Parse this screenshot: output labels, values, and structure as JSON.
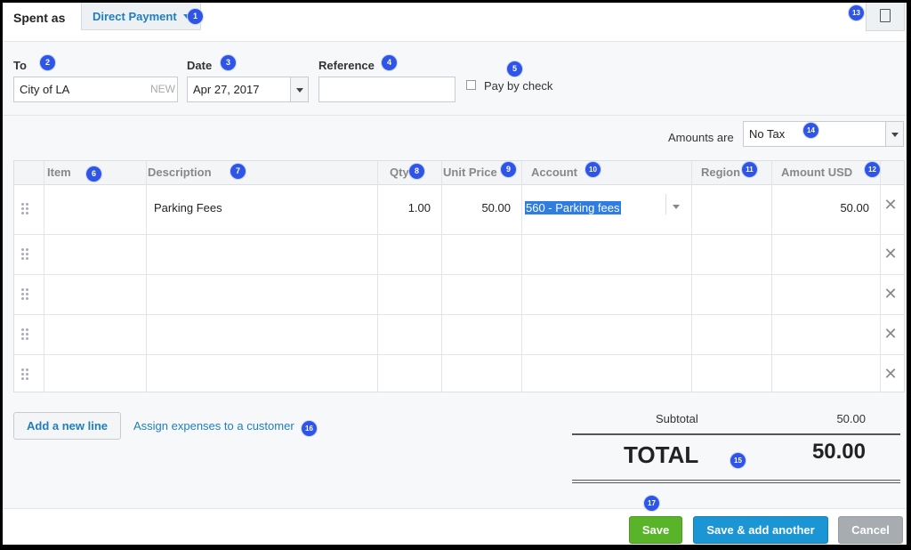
{
  "header": {
    "spent_as_label": "Spent as",
    "payment_type": "Direct Payment"
  },
  "fields": {
    "to_label": "To",
    "to_value": "City of LA",
    "to_new_tag": "NEW",
    "date_label": "Date",
    "date_value": "Apr 27, 2017",
    "reference_label": "Reference",
    "reference_value": "",
    "pay_by_check_label": "Pay by check",
    "pay_by_check_checked": false
  },
  "amounts": {
    "label": "Amounts are",
    "value": "No Tax"
  },
  "table": {
    "columns": [
      "Item",
      "Description",
      "Qty",
      "Unit Price",
      "Account",
      "Region",
      "Amount USD"
    ],
    "rows": [
      {
        "item": "",
        "description": "Parking Fees",
        "qty": "1.00",
        "unit_price": "50.00",
        "account": "560 - Parking fees",
        "region": "",
        "amount": "50.00"
      },
      {
        "item": "",
        "description": "",
        "qty": "",
        "unit_price": "",
        "account": "",
        "region": "",
        "amount": ""
      },
      {
        "item": "",
        "description": "",
        "qty": "",
        "unit_price": "",
        "account": "",
        "region": "",
        "amount": ""
      },
      {
        "item": "",
        "description": "",
        "qty": "",
        "unit_price": "",
        "account": "",
        "region": "",
        "amount": ""
      },
      {
        "item": "",
        "description": "",
        "qty": "",
        "unit_price": "",
        "account": "",
        "region": "",
        "amount": ""
      }
    ]
  },
  "actions": {
    "add_line": "Add a new line",
    "assign_customer": "Assign expenses to a customer"
  },
  "totals": {
    "subtotal_label": "Subtotal",
    "subtotal_value": "50.00",
    "total_label": "TOTAL",
    "total_value": "50.00"
  },
  "footer": {
    "save": "Save",
    "save_add": "Save & add another",
    "cancel": "Cancel"
  },
  "badges": [
    "1",
    "2",
    "3",
    "4",
    "5",
    "6",
    "7",
    "8",
    "9",
    "10",
    "11",
    "12",
    "13",
    "14",
    "15",
    "16",
    "17"
  ],
  "colors": {
    "link": "#1f7ec0",
    "save": "#5ab42a",
    "save_add": "#1b95d3",
    "cancel": "#a7acb1",
    "highlight": "#2f7de1",
    "badge": "#2f55e6"
  }
}
